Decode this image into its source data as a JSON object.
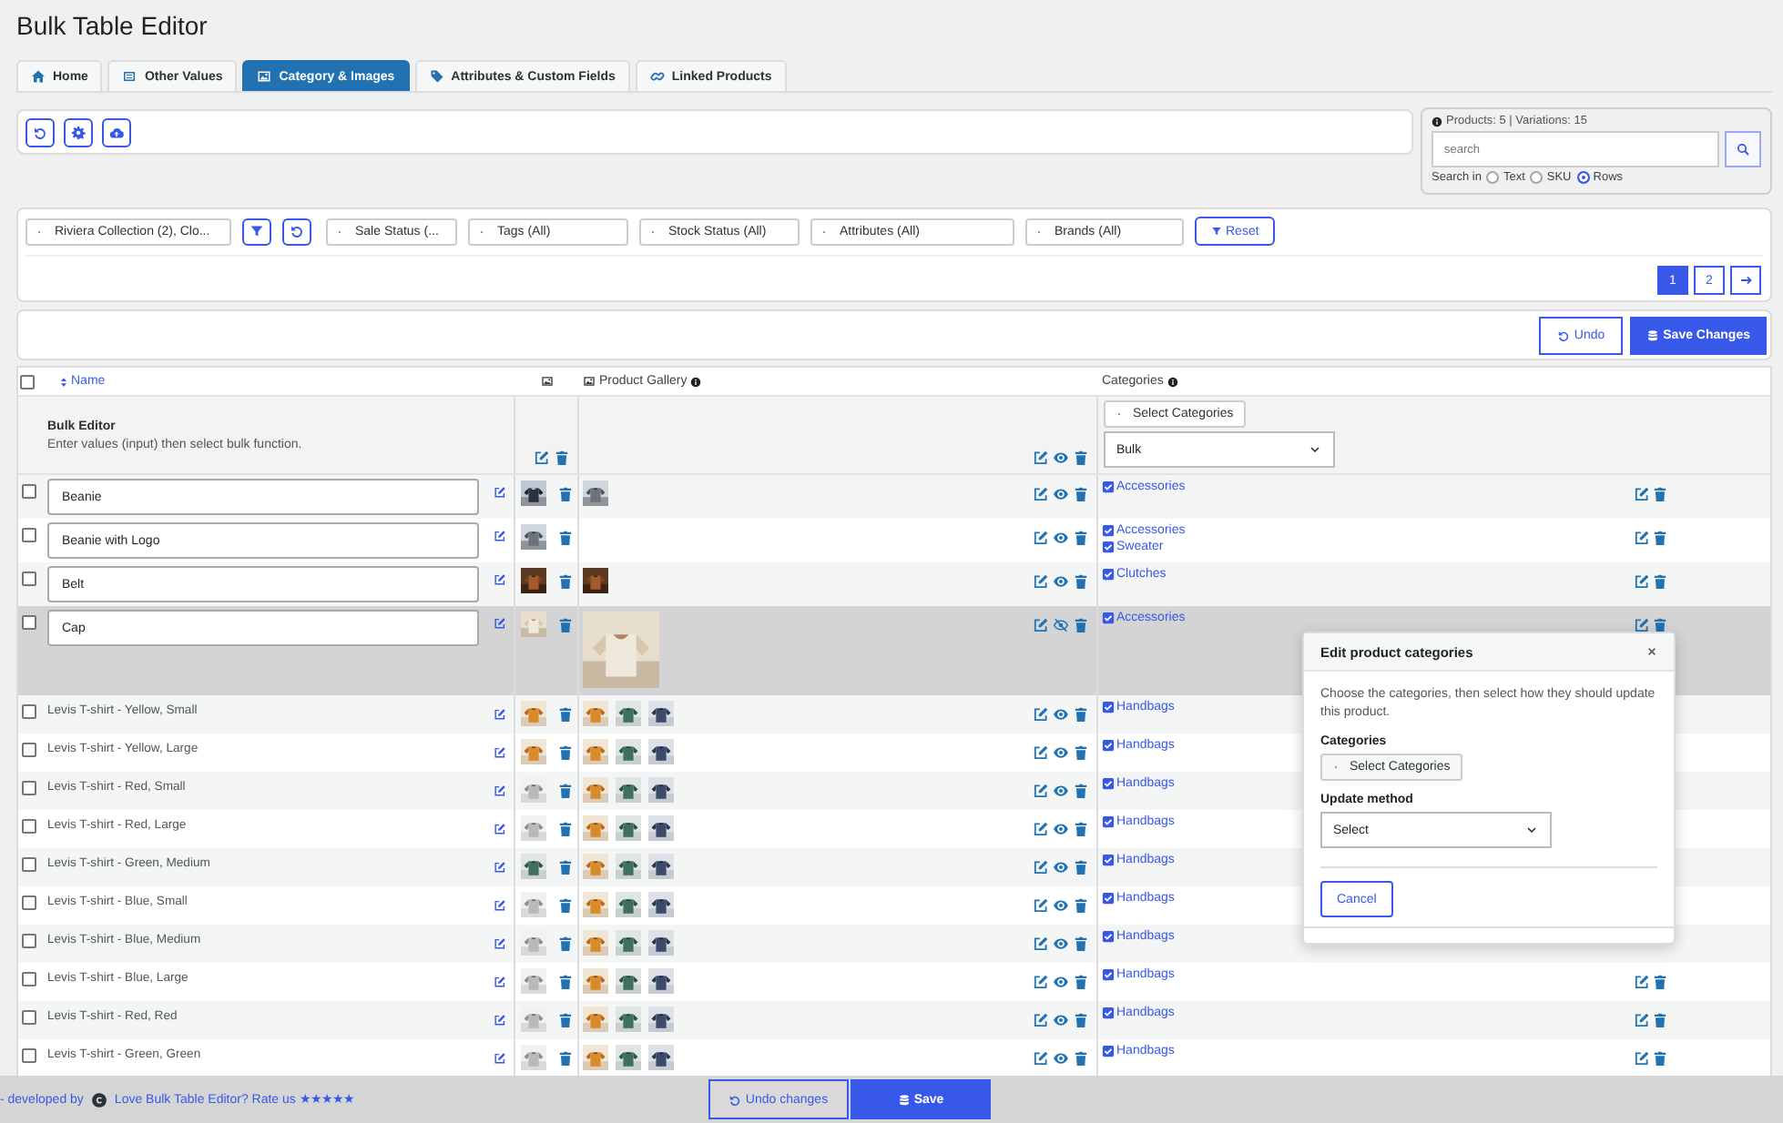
{
  "app": {
    "title": "Bulk Table Editor"
  },
  "tabs": [
    {
      "label": "Home",
      "selected": false
    },
    {
      "label": "Other Values",
      "selected": false
    },
    {
      "label": "Category & Images",
      "selected": true
    },
    {
      "label": "Attributes & Custom Fields",
      "selected": false
    },
    {
      "label": "Linked Products",
      "selected": false
    }
  ],
  "search": {
    "summary": "Products: 5 | Variations: 15",
    "placeholder": "search",
    "search_in_label": "Search in",
    "options": [
      {
        "label": "Text",
        "selected": false
      },
      {
        "label": "SKU",
        "selected": false
      },
      {
        "label": "Rows",
        "selected": true
      }
    ]
  },
  "filters": {
    "category": "Riviera Collection (2), Clo...",
    "dropdowns": [
      "Sale Status (...",
      "Tags (All)",
      "Stock Status (All)",
      "Attributes (All)",
      "Brands (All)"
    ],
    "reset": "Reset"
  },
  "pagination": [
    {
      "label": "1",
      "selected": true
    },
    {
      "label": "2",
      "selected": false
    }
  ],
  "actions": {
    "undo": "Undo",
    "save": "Save Changes"
  },
  "table": {
    "select_all": {
      "checked": false
    },
    "columns": {
      "name": "Name",
      "gallery": "Product Gallery",
      "categories": "Categories"
    },
    "bulk_editor": {
      "title": "Bulk Editor",
      "hint": "Enter values (input) then select bulk function.",
      "categories_button": "Select Categories",
      "method": "Bulk"
    },
    "rows": [
      {
        "name": "Beanie",
        "kind": "product",
        "checked": false,
        "active": false,
        "visible": true,
        "image": {
          "kind": "picture"
        },
        "gallery": [
          {
            "kind": "picture"
          }
        ],
        "categories": [
          {
            "label": "Accessories",
            "checked": true
          }
        ]
      },
      {
        "name": "Beanie with Logo",
        "kind": "product",
        "checked": false,
        "active": false,
        "visible": true,
        "image": {
          "kind": "picture"
        },
        "categories": [
          {
            "label": "Accessories",
            "checked": true
          },
          {
            "label": "Sweater",
            "checked": true
          }
        ]
      },
      {
        "name": "Belt",
        "kind": "product",
        "checked": false,
        "active": false,
        "visible": true,
        "image": {
          "kind": "picture"
        },
        "gallery": [
          {
            "kind": "picture"
          }
        ],
        "categories": [
          {
            "label": "Clutches",
            "checked": true
          }
        ]
      },
      {
        "name": "Cap",
        "kind": "product",
        "checked": false,
        "active": true,
        "visible": false,
        "image": {
          "kind": "picture"
        },
        "gallery": [
          {
            "kind": "picture"
          }
        ],
        "categories": [
          {
            "label": "Accessories",
            "checked": true
          }
        ]
      },
      {
        "name": "Levis T-shirt - Yellow, Small",
        "kind": "variation",
        "checked": false,
        "active": false,
        "visible": true,
        "image": {
          "kind": "picture"
        },
        "gallery": [
          {
            "kind": "picture"
          },
          {
            "kind": "picture"
          },
          {
            "kind": "picture"
          }
        ],
        "categories": [
          {
            "label": "Handbags",
            "checked": true
          }
        ]
      },
      {
        "name": "Levis T-shirt - Yellow, Large",
        "kind": "variation",
        "checked": false,
        "active": false,
        "visible": true,
        "image": {
          "kind": "picture"
        },
        "gallery": [
          {
            "kind": "picture"
          },
          {
            "kind": "picture"
          },
          {
            "kind": "picture"
          }
        ],
        "categories": [
          {
            "label": "Handbags",
            "checked": true
          }
        ]
      },
      {
        "name": "Levis T-shirt - Red, Small",
        "kind": "variation",
        "checked": false,
        "active": false,
        "visible": true,
        "image": {
          "kind": "picture"
        },
        "gallery": [
          {
            "kind": "picture"
          },
          {
            "kind": "picture"
          },
          {
            "kind": "picture"
          }
        ],
        "categories": [
          {
            "label": "Handbags",
            "checked": true
          }
        ]
      },
      {
        "name": "Levis T-shirt - Red, Large",
        "kind": "variation",
        "checked": false,
        "active": false,
        "visible": true,
        "image": {
          "kind": "picture"
        },
        "gallery": [
          {
            "kind": "picture"
          },
          {
            "kind": "picture"
          },
          {
            "kind": "picture"
          }
        ],
        "categories": [
          {
            "label": "Handbags",
            "checked": true
          }
        ]
      },
      {
        "name": "Levis T-shirt - Green, Medium",
        "kind": "variation",
        "checked": false,
        "active": false,
        "visible": true,
        "image": {
          "kind": "picture"
        },
        "gallery": [
          {
            "kind": "picture"
          },
          {
            "kind": "picture"
          },
          {
            "kind": "picture"
          }
        ],
        "categories": [
          {
            "label": "Handbags",
            "checked": true
          }
        ]
      },
      {
        "name": "Levis T-shirt - Blue, Small",
        "kind": "variation",
        "checked": false,
        "active": false,
        "visible": true,
        "image": {
          "kind": "picture"
        },
        "gallery": [
          {
            "kind": "picture"
          },
          {
            "kind": "picture"
          },
          {
            "kind": "picture"
          }
        ],
        "categories": [
          {
            "label": "Handbags",
            "checked": true
          }
        ]
      },
      {
        "name": "Levis T-shirt - Blue, Medium",
        "kind": "variation",
        "checked": false,
        "active": false,
        "visible": true,
        "image": {
          "kind": "picture"
        },
        "gallery": [
          {
            "kind": "picture"
          },
          {
            "kind": "picture"
          },
          {
            "kind": "picture"
          }
        ],
        "categories": [
          {
            "label": "Handbags",
            "checked": true
          }
        ]
      },
      {
        "name": "Levis T-shirt - Blue, Large",
        "kind": "variation",
        "checked": false,
        "active": false,
        "visible": true,
        "image": {
          "kind": "picture"
        },
        "gallery": [
          {
            "kind": "picture"
          },
          {
            "kind": "picture"
          },
          {
            "kind": "picture"
          }
        ],
        "categories": [
          {
            "label": "Handbags",
            "checked": true
          }
        ]
      },
      {
        "name": "Levis T-shirt - Red, Red",
        "kind": "variation",
        "checked": false,
        "active": false,
        "visible": true,
        "image": {
          "kind": "picture"
        },
        "gallery": [
          {
            "kind": "picture"
          },
          {
            "kind": "picture"
          },
          {
            "kind": "picture"
          }
        ],
        "categories": [
          {
            "label": "Handbags",
            "checked": true
          }
        ]
      },
      {
        "name": "Levis T-shirt - Green, Green",
        "kind": "variation",
        "checked": false,
        "active": false,
        "visible": true,
        "image": {
          "kind": "picture"
        },
        "gallery": [
          {
            "kind": "picture"
          },
          {
            "kind": "picture"
          },
          {
            "kind": "picture"
          }
        ],
        "categories": [
          {
            "label": "Handbags",
            "checked": true
          }
        ]
      }
    ]
  },
  "modal": {
    "title": "Edit product categories",
    "description": "Choose the categories, then select how they should update this product.",
    "categories_label": "Categories",
    "categories_button": "Select Categories",
    "method_label": "Update method",
    "method_value": "Select",
    "cancel": "Cancel"
  },
  "footer": {
    "credit": "- developed by",
    "rate": "Love Bulk Table Editor? Rate us ★★★★★",
    "undo": "Undo changes",
    "save": "Save"
  }
}
